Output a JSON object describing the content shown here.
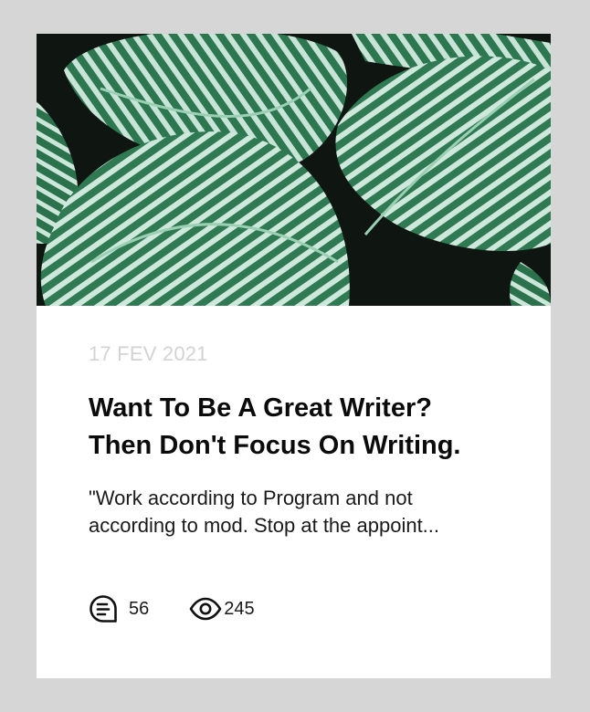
{
  "card": {
    "image": {
      "subject": "striped green calathea leaves",
      "colors": {
        "background": "#0f1612",
        "leaf_dark": "#2f7a52",
        "leaf_light": "#cfe8dc",
        "midrib": "#9bd0b5"
      }
    },
    "date": "17 FEV 2021",
    "title_line1": "Want To Be A Great Writer?",
    "title_line2": "Then Don't Focus On Writing.",
    "excerpt_line1": "\"Work according to Program and not",
    "excerpt_line2": "according to mod. Stop at the appoint...",
    "stats": {
      "comments": {
        "icon": "comment-icon",
        "count": "56"
      },
      "views": {
        "icon": "eye-icon",
        "count": "245"
      }
    }
  }
}
